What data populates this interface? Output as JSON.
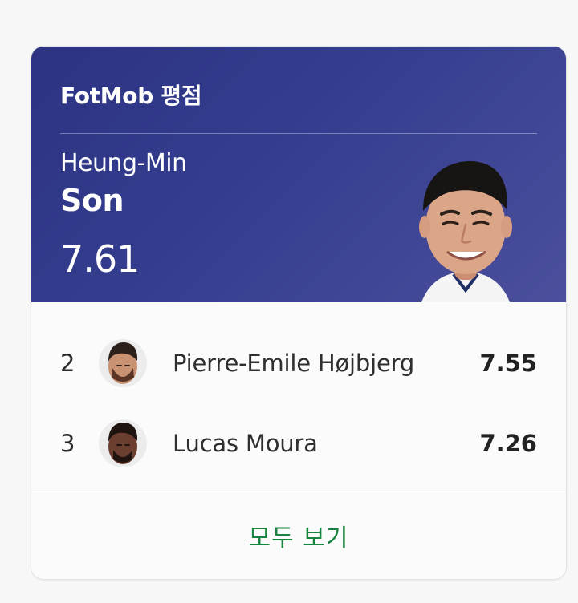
{
  "card": {
    "title": "FotMob 평점",
    "top_player": {
      "first_name": "Heung-Min",
      "last_name": "Son",
      "rating": "7.61"
    },
    "rankings": [
      {
        "rank": "2",
        "name": "Pierre-Emile Højbjerg",
        "rating": "7.55"
      },
      {
        "rank": "3",
        "name": "Lucas Moura",
        "rating": "7.26"
      }
    ],
    "view_all_label": "모두 보기"
  },
  "colors": {
    "hero_start": "#2d3382",
    "hero_end": "#4b4f9c",
    "link_green": "#19843f"
  },
  "icons": {
    "top_player_photo": "player-photo-icon",
    "ranking_avatar": "player-avatar-icon"
  }
}
